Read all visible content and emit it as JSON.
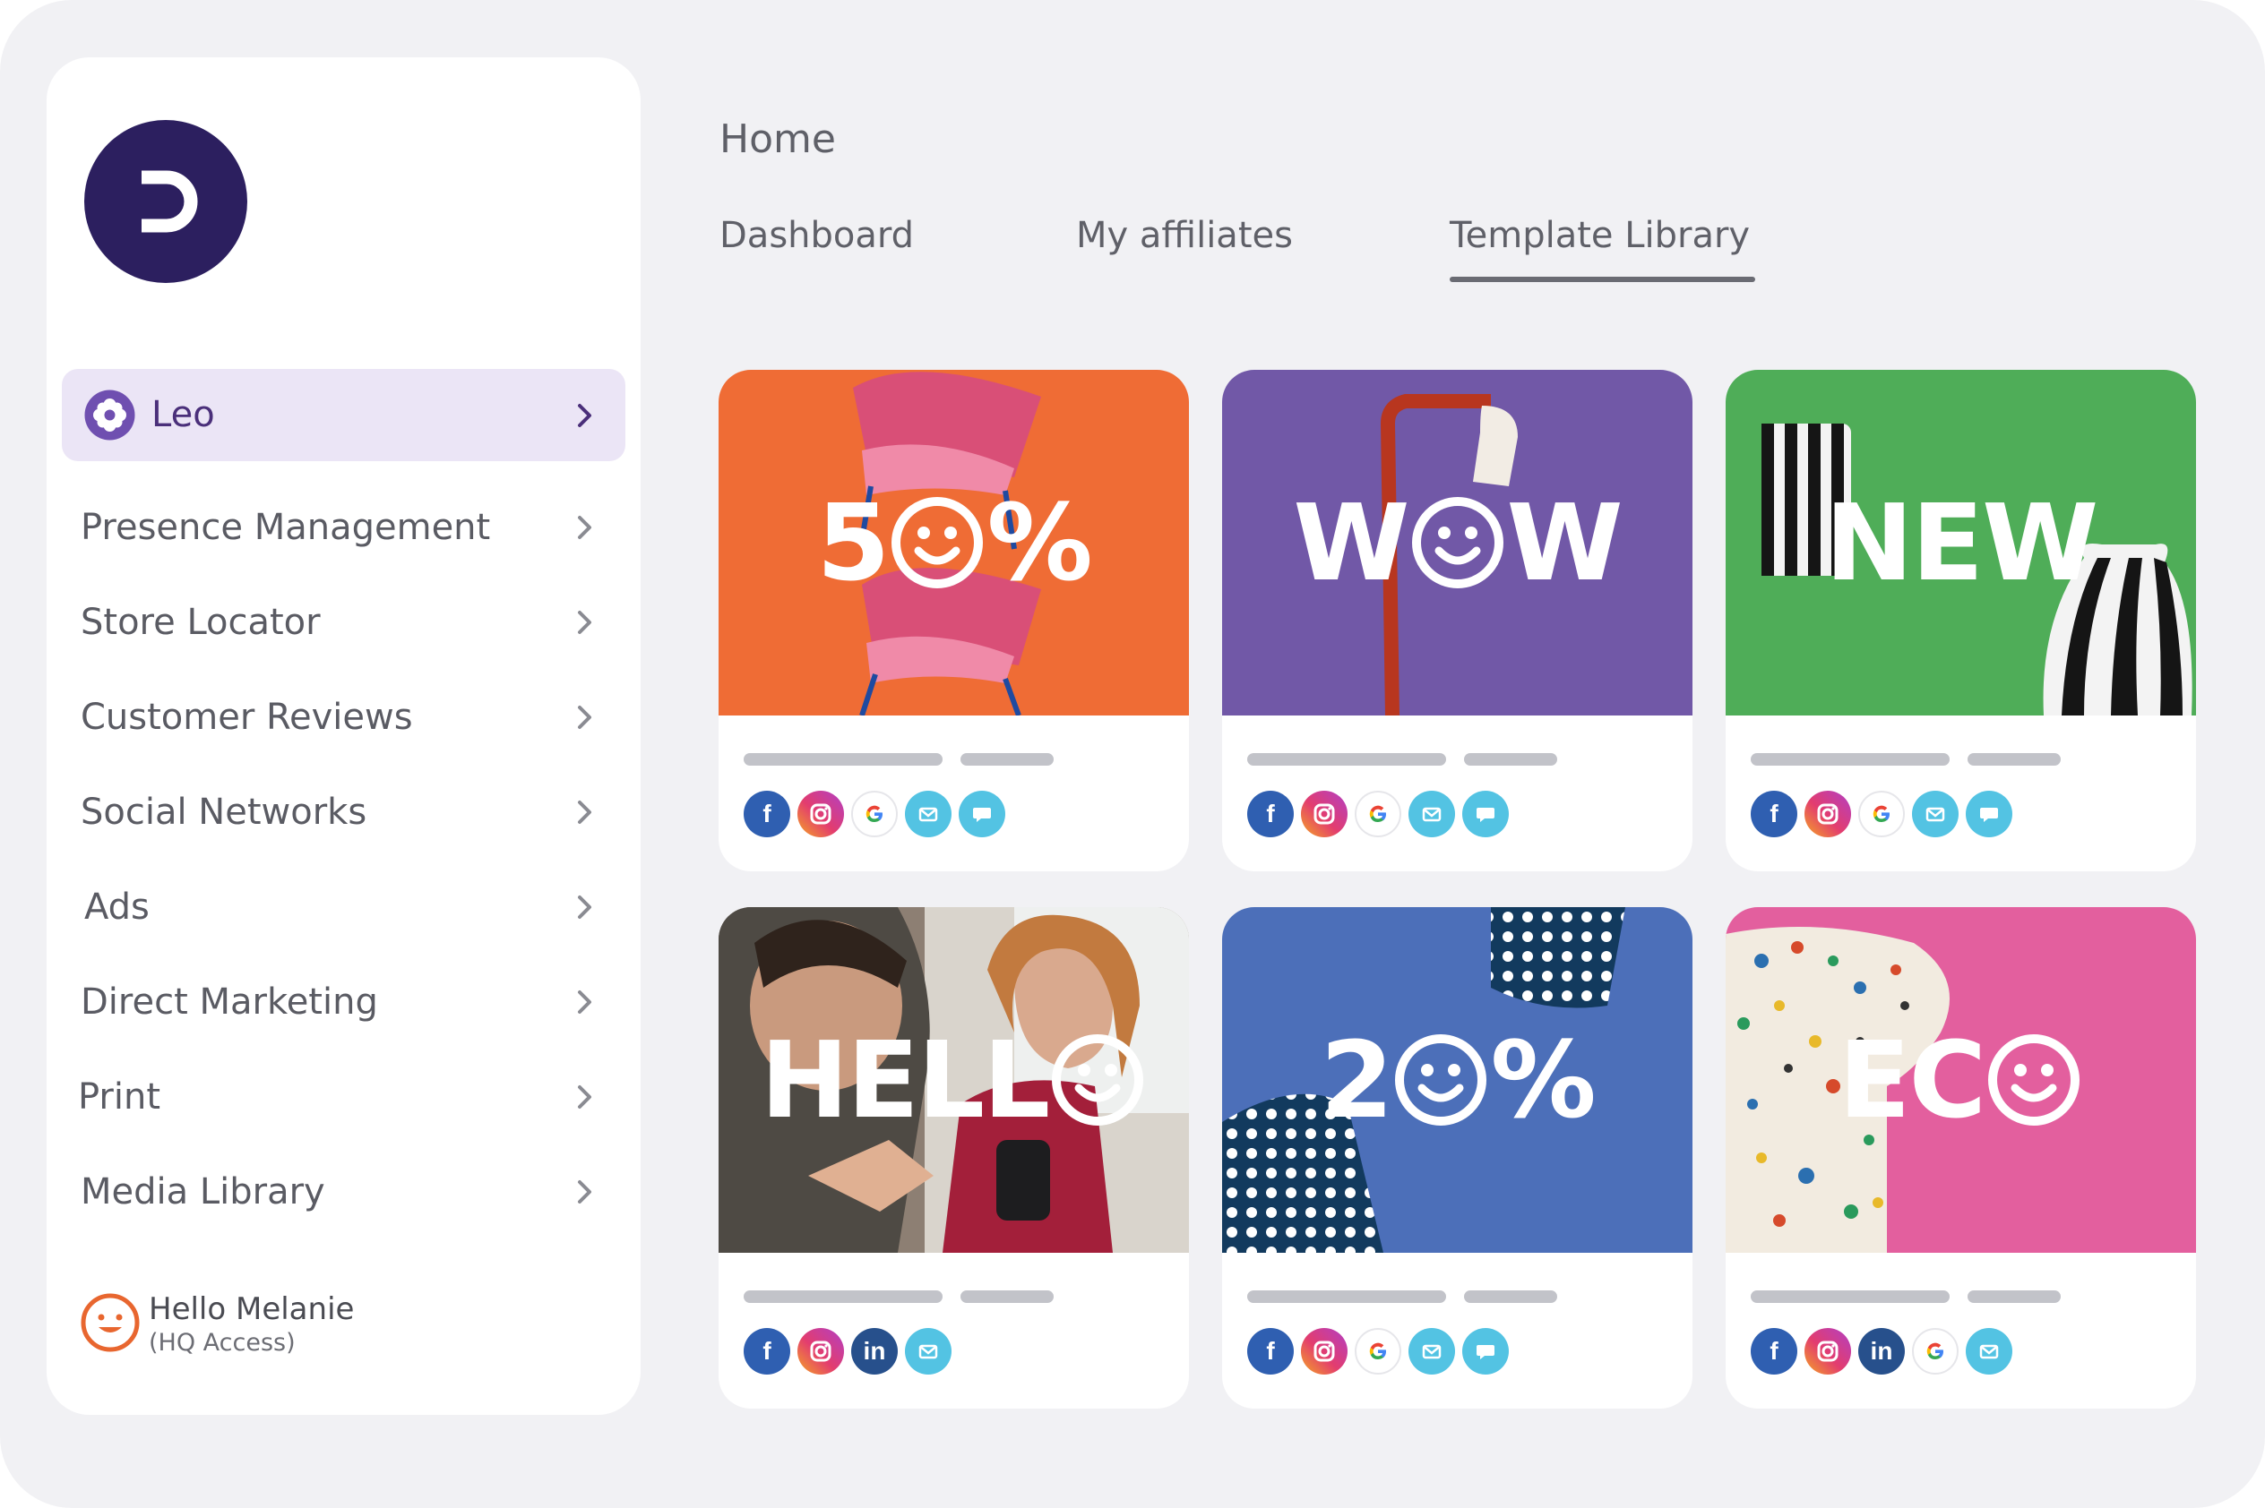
{
  "page": {
    "title": "Home",
    "tabs": [
      {
        "label": "Dashboard",
        "active": false
      },
      {
        "label": "My affiliates",
        "active": false
      },
      {
        "label": "Template Library",
        "active": true
      }
    ]
  },
  "sidebar": {
    "logo": "brand-logo",
    "active_item": {
      "label": "Leo",
      "icon": "flower-icon"
    },
    "items": [
      {
        "label": "Presence Management"
      },
      {
        "label": "Store Locator"
      },
      {
        "label": "Customer Reviews"
      },
      {
        "label": "Social Networks"
      },
      {
        "label": "Ads"
      },
      {
        "label": "Direct Marketing"
      },
      {
        "label": "Print"
      },
      {
        "label": "Media Library"
      }
    ],
    "user": {
      "greeting": "Hello Melanie",
      "role": "(HQ Access)"
    }
  },
  "templates": [
    {
      "before": "5",
      "after": "%",
      "bg": "#ef6c35",
      "channels": [
        "facebook",
        "instagram",
        "google",
        "email",
        "chat"
      ]
    },
    {
      "before": "W",
      "after": "W",
      "bg": "#7158a7",
      "channels": [
        "facebook",
        "instagram",
        "google",
        "email",
        "chat"
      ]
    },
    {
      "before": "NEW",
      "after": "",
      "bg": "#4fad58",
      "channels": [
        "facebook",
        "instagram",
        "google",
        "email",
        "chat"
      ]
    },
    {
      "before": "HELL",
      "after": "",
      "bg": "#7a6a5e",
      "channels": [
        "facebook",
        "instagram",
        "linkedin",
        "email"
      ]
    },
    {
      "before": "2",
      "after": "%",
      "bg": "#4c6fb9",
      "channels": [
        "facebook",
        "instagram",
        "google",
        "email",
        "chat"
      ]
    },
    {
      "before": "EC",
      "after": "",
      "bg": "#e35f9e",
      "channels": [
        "facebook",
        "instagram",
        "linkedin",
        "google",
        "email"
      ]
    }
  ],
  "colors": {
    "accent": "#2c1f5f",
    "active_bg": "#ebe5f6",
    "social_email": "#53c3e3",
    "social_facebook": "#2f5fb1"
  }
}
